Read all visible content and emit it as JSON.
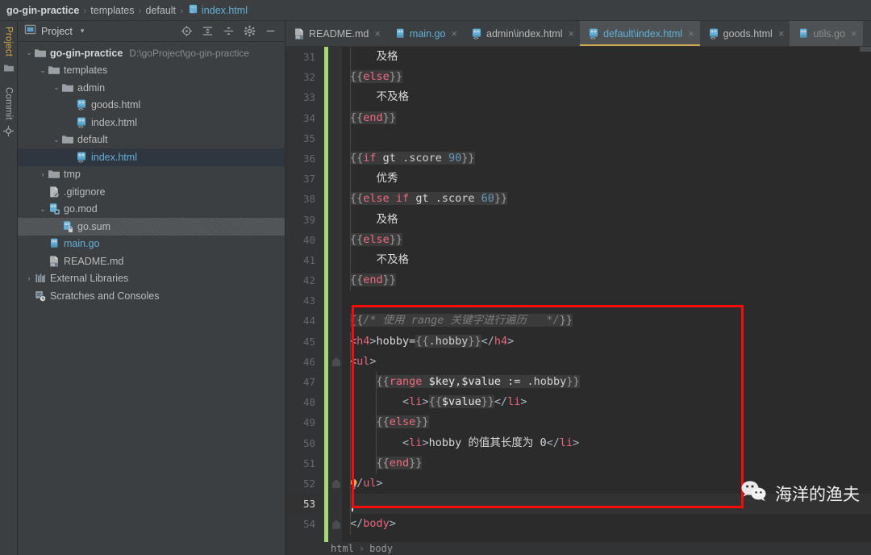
{
  "breadcrumb": {
    "items": [
      {
        "label": "go-gin-practice",
        "style": "bold"
      },
      {
        "label": "templates",
        "style": "plain"
      },
      {
        "label": "default",
        "style": "plain"
      },
      {
        "label": "index.html",
        "style": "link",
        "icon": "html-file-icon"
      }
    ],
    "separator": "›"
  },
  "toolstrip": {
    "project_tab": "Project",
    "commit_tab": "Commit",
    "folder_icon": "folder-icon",
    "commit_icon": "commit-icon"
  },
  "project_panel": {
    "title": "Project",
    "caret": "▾",
    "window_icon": "project-window-icon",
    "tools": [
      {
        "name": "locate-icon",
        "label": "Select Opened File"
      },
      {
        "name": "expand-all-icon",
        "label": "Expand All"
      },
      {
        "name": "collapse-all-icon",
        "label": "Collapse All"
      },
      {
        "name": "gear-icon",
        "label": "Options"
      },
      {
        "name": "minimize-icon",
        "label": "Hide"
      }
    ],
    "tree": [
      {
        "depth": 0,
        "arrow": "⌄",
        "icon": "folder-icon",
        "label": "go-gin-practice",
        "style": "bold",
        "path": "D:\\goProject\\go-gin-practice",
        "state": "none"
      },
      {
        "depth": 1,
        "arrow": "⌄",
        "icon": "folder-icon",
        "label": "templates",
        "style": "plain",
        "path": "",
        "state": "none"
      },
      {
        "depth": 2,
        "arrow": "⌄",
        "icon": "folder-icon",
        "label": "admin",
        "style": "plain",
        "path": "",
        "state": "none"
      },
      {
        "depth": 3,
        "arrow": "",
        "icon": "html-file-icon",
        "label": "goods.html",
        "style": "plain",
        "path": "",
        "state": "none"
      },
      {
        "depth": 3,
        "arrow": "",
        "icon": "html-file-icon",
        "label": "index.html",
        "style": "plain",
        "path": "",
        "state": "none"
      },
      {
        "depth": 2,
        "arrow": "⌄",
        "icon": "folder-icon",
        "label": "default",
        "style": "plain",
        "path": "",
        "state": "none"
      },
      {
        "depth": 3,
        "arrow": "",
        "icon": "html-file-icon",
        "label": "index.html",
        "style": "blue",
        "path": "",
        "state": "selected-file"
      },
      {
        "depth": 1,
        "arrow": "›",
        "icon": "folder-icon",
        "label": "tmp",
        "style": "plain",
        "path": "",
        "state": "none"
      },
      {
        "depth": 1,
        "arrow": "",
        "icon": "gitignore-icon",
        "label": ".gitignore",
        "style": "plain",
        "path": "",
        "state": "none"
      },
      {
        "depth": 1,
        "arrow": "⌄",
        "icon": "gomod-icon",
        "label": "go.mod",
        "style": "plain",
        "path": "",
        "state": "none"
      },
      {
        "depth": 2,
        "arrow": "",
        "icon": "gosum-icon",
        "label": "go.sum",
        "style": "plain",
        "path": "",
        "state": "hatched"
      },
      {
        "depth": 1,
        "arrow": "",
        "icon": "go-file-icon",
        "label": "main.go",
        "style": "blue",
        "path": "",
        "state": "none"
      },
      {
        "depth": 1,
        "arrow": "",
        "icon": "markdown-icon",
        "label": "README.md",
        "style": "plain",
        "path": "",
        "state": "none"
      },
      {
        "depth": 0,
        "arrow": "›",
        "icon": "library-icon",
        "label": "External Libraries",
        "style": "plain",
        "path": "",
        "state": "none"
      },
      {
        "depth": 0,
        "arrow": "",
        "icon": "scratches-icon",
        "label": "Scratches and Consoles",
        "style": "plain",
        "path": "",
        "state": "none"
      }
    ]
  },
  "editor_tabs": [
    {
      "label": "README.md",
      "icon": "markdown-icon",
      "close": "×",
      "state": "inactive",
      "color": "plain"
    },
    {
      "label": "main.go",
      "icon": "go-file-icon",
      "close": "×",
      "state": "inactive",
      "color": "blue"
    },
    {
      "label": "admin\\index.html",
      "icon": "html-file-icon",
      "close": "×",
      "state": "inactive",
      "color": "plain"
    },
    {
      "label": "default\\index.html",
      "icon": "html-file-icon",
      "close": "×",
      "state": "active",
      "color": "blue"
    },
    {
      "label": "goods.html",
      "icon": "html-file-icon",
      "close": "×",
      "state": "inactive",
      "color": "plain"
    },
    {
      "label": "utils.go",
      "icon": "go-file-icon",
      "close": "×",
      "state": "selected",
      "color": "dim"
    }
  ],
  "code": {
    "first_line": 31,
    "current_line": 53,
    "lines": [
      {
        "n": 31,
        "text": "    及格"
      },
      {
        "n": 32,
        "text": "{{else}}"
      },
      {
        "n": 33,
        "text": "    不及格"
      },
      {
        "n": 34,
        "text": "{{end}}"
      },
      {
        "n": 35,
        "text": ""
      },
      {
        "n": 36,
        "text": "{{if gt .score 90}}"
      },
      {
        "n": 37,
        "text": "    优秀"
      },
      {
        "n": 38,
        "text": "{{else if gt .score 60}}"
      },
      {
        "n": 39,
        "text": "    及格"
      },
      {
        "n": 40,
        "text": "{{else}}"
      },
      {
        "n": 41,
        "text": "    不及格"
      },
      {
        "n": 42,
        "text": "{{end}}"
      },
      {
        "n": 43,
        "text": ""
      },
      {
        "n": 44,
        "text": "{{/* 使用 range 关键字进行遍历   */}}"
      },
      {
        "n": 45,
        "text": "<h4>hobby={{.hobby}}</h4>"
      },
      {
        "n": 46,
        "text": "<ul>"
      },
      {
        "n": 47,
        "text": "    {{range $key,$value := .hobby}}"
      },
      {
        "n": 48,
        "text": "        <li>{{$value}}</li>"
      },
      {
        "n": 49,
        "text": "    {{else}}"
      },
      {
        "n": 50,
        "text": "        <li>hobby 的值其长度为 0</li>"
      },
      {
        "n": 51,
        "text": "    {{end}}"
      },
      {
        "n": 52,
        "text": "</ul>"
      },
      {
        "n": 53,
        "text": ""
      },
      {
        "n": 54,
        "text": "</body>"
      }
    ],
    "gutter_icons": [
      {
        "type": "fold-marker",
        "line": 46
      },
      {
        "type": "fold-marker",
        "line": 52
      },
      {
        "type": "lightbulb-icon",
        "line": 52
      },
      {
        "type": "fold-marker",
        "line": 54
      }
    ],
    "vcs_marker": {
      "color": "#a8d977",
      "from_line": 31,
      "to_line": 54
    }
  },
  "annotation": {
    "box_color": "#fb0a0a",
    "label": "range-loop-highlight"
  },
  "watermark": {
    "text": "海洋的渔夫",
    "icon": "wechat-icon"
  },
  "bottom_breadcrumb": {
    "items": [
      "html",
      "body"
    ],
    "separator": "›"
  },
  "colors": {
    "panel_bg": "#3c3f41",
    "editor_bg": "#2b2b2b",
    "gutter_bg": "#313335",
    "accent_blue": "#62b0d8",
    "accent_gold": "#cfa850",
    "keyword_pink": "#f0687f",
    "tag_pink": "#e8657d",
    "number_blue": "#6897bb",
    "vcs_green": "#a8d977",
    "annotation_red": "#fb0a0a"
  }
}
